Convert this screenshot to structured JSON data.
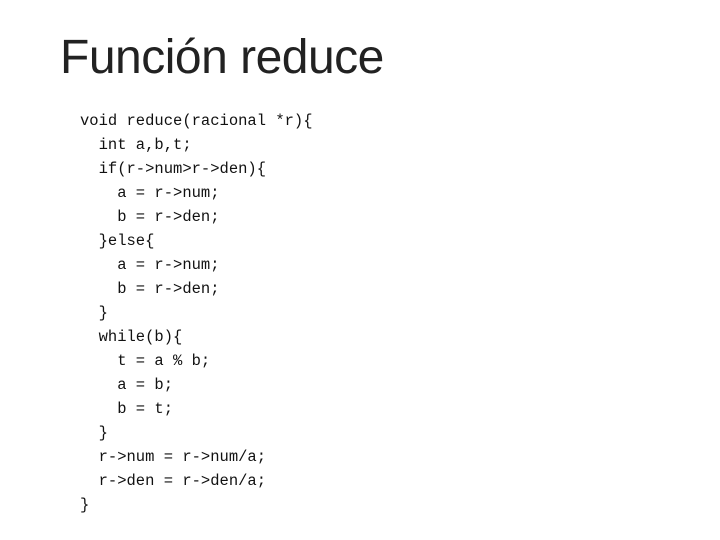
{
  "slide": {
    "title": "Función reduce",
    "code": {
      "lines": [
        "void reduce(racional *r){",
        "  int a,b,t;",
        "  if(r->num>r->den){",
        "    a = r->num;",
        "    b = r->den;",
        "  }else{",
        "    a = r->num;",
        "    b = r->den;",
        "  }",
        "  while(b){",
        "    t = a % b;",
        "    a = b;",
        "    b = t;",
        "  }",
        "  r->num = r->num/a;",
        "  r->den = r->den/a;",
        "}"
      ]
    }
  }
}
